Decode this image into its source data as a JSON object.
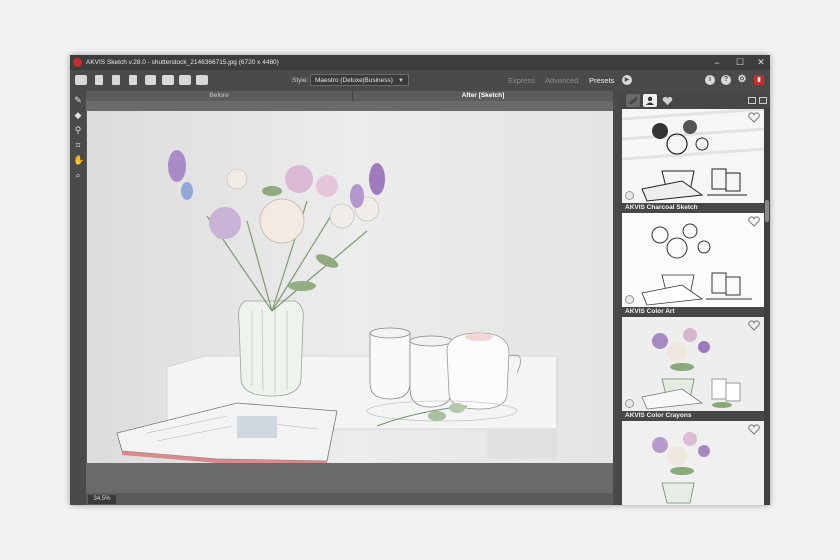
{
  "window": {
    "title": "AKVIS Sketch v.28.0 - shutterstock_2146366715.jpg (6720 x 4480)",
    "controls": {
      "minimize": "−",
      "maximize": "☐",
      "close": "✕"
    }
  },
  "toolbar": {
    "icons": [
      "home-icon",
      "open-icon",
      "save-icon",
      "export-icon",
      "print-icon",
      "batch-icon",
      "share-icon",
      "plugin-icon"
    ],
    "style_label": "Style:",
    "style_value": "Maestro (Deluxe|Business)",
    "modes": {
      "express": "Express",
      "advanced": "Advanced",
      "presets": "Presets"
    },
    "right_icons": {
      "info": "i",
      "help": "?",
      "settings": "⚙",
      "book": "▮"
    }
  },
  "tools": [
    "pencil-tool",
    "eraser-tool",
    "stamp-tool",
    "crop-tool",
    "hand-tool",
    "zoom-tool"
  ],
  "canvas": {
    "tab_before": "Before",
    "tab_after": "After [Sketch]",
    "zoom": "34.5%"
  },
  "presets_panel": {
    "items": [
      {
        "label": "AKVIS Charcoal Sketch",
        "style": "charcoal"
      },
      {
        "label": "AKVIS Color Art",
        "style": "lineart"
      },
      {
        "label": "AKVIS Color Crayons",
        "style": "color"
      },
      {
        "label": "",
        "style": "color"
      }
    ]
  },
  "colors": {
    "title_bg": "#3d3d3d",
    "toolbar_bg": "#4a4a4a",
    "panel_bg": "#474747",
    "accent_red": "#c62d2d"
  }
}
